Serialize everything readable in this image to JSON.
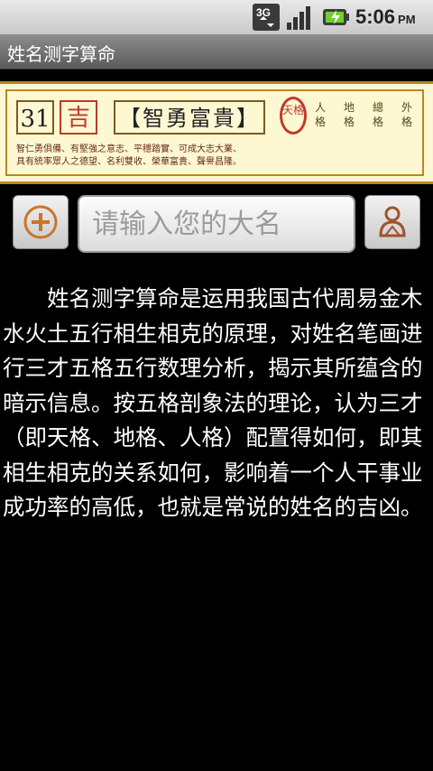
{
  "status_bar": {
    "network": "3G",
    "time": "5:06",
    "ampm": "PM"
  },
  "app": {
    "title": "姓名测字算命"
  },
  "banner": {
    "number": "31",
    "fortune": "吉",
    "motto": "【智勇富貴】",
    "tian": "天格",
    "ge_labels": [
      "人格",
      "地格",
      "總格",
      "外格"
    ],
    "text_line1": "智仁勇俱備、有堅強之意志、平穩踏實、可成大志大業、",
    "text_line2": "具有統率眾人之德望、名利雙收、榮華富貴、聲譽昌隆。"
  },
  "input": {
    "placeholder": "请输入您的大名"
  },
  "description": "姓名测字算命是运用我国古代周易金木水火土五行相生相克的原理，对姓名笔画进行三才五格五行数理分析，揭示其所蕴含的暗示信息。按五格剖象法的理论，认为三才（即天格、地格、人格）配置得如何，即其相生相克的关系如何，影响着一个人干事业成功率的高低，也就是常说的姓名的吉凶。"
}
